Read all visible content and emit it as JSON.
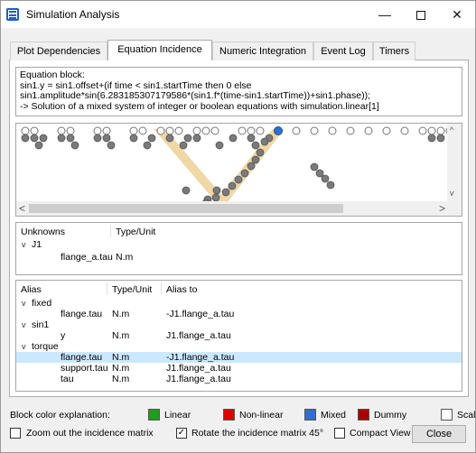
{
  "window": {
    "title": "Simulation Analysis",
    "minimize_glyph": "—",
    "close_glyph": "✕"
  },
  "tabs": [
    {
      "label": "Plot Dependencies",
      "active": false
    },
    {
      "label": "Equation Incidence",
      "active": true
    },
    {
      "label": "Numeric Integration",
      "active": false
    },
    {
      "label": "Event Log",
      "active": false
    },
    {
      "label": "Timers",
      "active": false
    }
  ],
  "equation": {
    "lines": [
      "Equation block:",
      "sin1.y = sin1.offset+(if time < sin1.startTime then 0 else",
      "sin1.amplitude*sin(6.283185307179586*(sin1.f*(time-sin1.startTime))+sin1.phase));",
      "-> Solution of a mixed system of integer or boolean equations with simulation.linear[1]"
    ]
  },
  "matrix": {
    "scroll_left": "<",
    "scroll_right": ">",
    "scroll_up": "^",
    "scroll_down": "v",
    "colors": {
      "empty": "#ffffff",
      "filled": "#7a7a7a",
      "highlight": "#2f6fd0",
      "band": "#efd7a6"
    }
  },
  "unknowns": {
    "headers": [
      "Unknowns",
      "Type/Unit"
    ],
    "rows": [
      {
        "indent": 0,
        "expander": "v",
        "name": "J1",
        "type": ""
      },
      {
        "indent": 2,
        "expander": "",
        "name": "flange_a.tau",
        "type": "N.m"
      }
    ]
  },
  "aliases": {
    "headers": [
      "Alias",
      "Type/Unit",
      "Alias to"
    ],
    "rows": [
      {
        "indent": 0,
        "expander": "v",
        "name": "fixed",
        "type": "",
        "alias": "",
        "selected": false
      },
      {
        "indent": 2,
        "expander": "",
        "name": "flange.tau",
        "type": "N.m",
        "alias": "-J1.flange_a.tau",
        "selected": false
      },
      {
        "indent": 0,
        "expander": "v",
        "name": "sin1",
        "type": "",
        "alias": "",
        "selected": false
      },
      {
        "indent": 2,
        "expander": "",
        "name": "y",
        "type": "N.m",
        "alias": "J1.flange_a.tau",
        "selected": false
      },
      {
        "indent": 0,
        "expander": "v",
        "name": "torque",
        "type": "",
        "alias": "",
        "selected": false
      },
      {
        "indent": 2,
        "expander": "",
        "name": "flange.tau",
        "type": "N.m",
        "alias": "-J1.flange_a.tau",
        "selected": true
      },
      {
        "indent": 2,
        "expander": "",
        "name": "support.tau",
        "type": "N.m",
        "alias": "J1.flange_a.tau",
        "selected": false
      },
      {
        "indent": 2,
        "expander": "",
        "name": "tau",
        "type": "N.m",
        "alias": "J1.flange_a.tau",
        "selected": false
      }
    ]
  },
  "legend": {
    "title": "Block color explanation:",
    "items": [
      {
        "label": "Linear",
        "color": "#1aa01a"
      },
      {
        "label": "Non-linear",
        "color": "#dd0000"
      },
      {
        "label": "Mixed",
        "color": "#2f6fd0"
      },
      {
        "label": "Dummy",
        "color": "#aa0000"
      },
      {
        "label": "Scalar",
        "color": "#ffffff"
      }
    ]
  },
  "options": {
    "zoom_out": {
      "label": "Zoom out the incidence matrix",
      "checked": false
    },
    "rotate": {
      "label": "Rotate the incidence matrix 45°",
      "checked": true
    },
    "compact": {
      "label": "Compact View",
      "checked": false
    },
    "close_label": "Close"
  }
}
